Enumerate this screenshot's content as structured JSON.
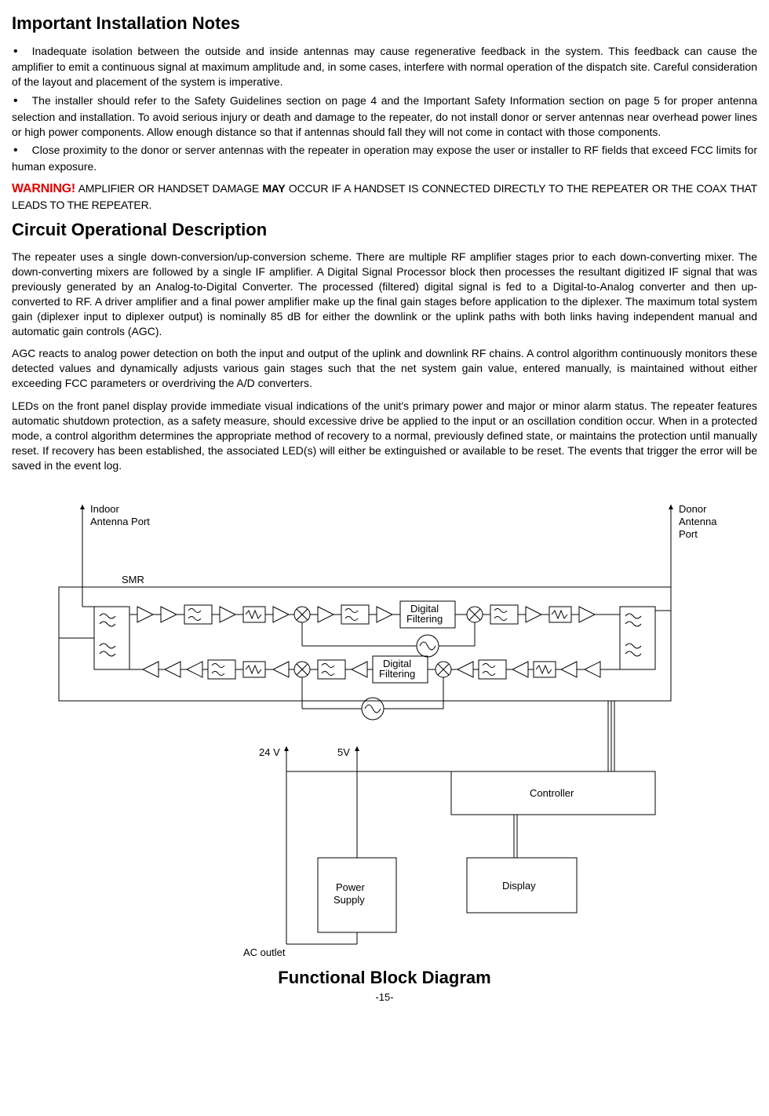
{
  "headings": {
    "install_notes": "Important Installation Notes",
    "circuit_desc": "Circuit Operational Description"
  },
  "bullets": {
    "b1": "Inadequate isolation between the outside and inside antennas may cause regenerative feedback in the system. This feedback can cause the amplifier to emit a continuous signal at maximum amplitude and, in some cases, interfere with normal operation of the dispatch site. Careful consideration of the layout and placement of the system is imperative.",
    "b2": "The installer should refer to the Safety Guidelines section on page 4 and the Important Safety Information section on page 5 for proper antenna selection and installation. To avoid serious injury or death and damage to the repeater, do not install donor or server antennas near overhead power lines or high power components.   Allow enough distance so that if antennas should fall they will not come in contact  with those components.",
    "b3": "Close proximity  to the donor or server antennas with the repeater in operation may expose the user or installer to RF fields that exceed FCC limits for human exposure."
  },
  "warning": {
    "label": "WARNING!",
    "pre": " AMPLIFIER OR HANDSET DAMAGE ",
    "bold": "MAY",
    "post": " OCCUR IF A HANDSET IS CONNECTED DIRECTLY TO THE REPEATER OR THE COAX THAT LEADS TO THE REPEATER."
  },
  "circuit": {
    "p1": "The repeater uses a single down-conversion/up-conversion scheme. There are multiple  RF amplifier stages prior to each down-converting mixer. The down-converting mixers are followed by a single IF amplifier. A Digital Signal Processor block then processes the resultant digitized IF signal that was previously generated by an Analog-to-Digital Converter. The processed (filtered) digital signal is fed to a Digital-to-Analog converter and then up-converted to RF. A driver amplifier and a final power amplifier make up the final gain stages before application to the diplexer. The maximum total system gain (diplexer input to diplexer output) is nominally 85 dB for either the downlink  or the uplink paths with both links having independent manual and automatic gain controls (AGC).",
    "p2": "AGC reacts to analog power detection on both the input and output of the uplink and downlink RF chains. A control algorithm continuously monitors these detected values and dynamically adjusts various gain stages  such that the net system gain value, entered manually, is maintained without either exceeding FCC parameters or overdriving the A/D converters.",
    "p3": "LEDs on the front panel display provide immediate visual indications of the unit's primary power and major or minor alarm status. The repeater features automatic shutdown protection, as a safety measure, should excessive drive be applied to the input or an oscillation condition occur. When in a protected mode, a control algorithm determines the appropriate method of recovery to a normal, previously defined state, or maintains the protection until manually reset. If recovery has been established, the associated LED(s) will either be extinguished or available to be reset. The events that trigger the error will be saved in the event log."
  },
  "diagram": {
    "title": "Functional Block Diagram",
    "labels": {
      "indoor": "Indoor",
      "antenna_port": "Antenna Port",
      "donor": "Donor",
      "antenna": "Antenna",
      "port": "Port",
      "smr": "SMR",
      "digital": "Digital",
      "filtering": "Filtering",
      "controller": "Controller",
      "display": "Display",
      "power": "Power",
      "supply": "Supply",
      "v24": "24 V",
      "v5": "5V",
      "ac_outlet": "AC outlet"
    }
  },
  "page_number": "-15-"
}
